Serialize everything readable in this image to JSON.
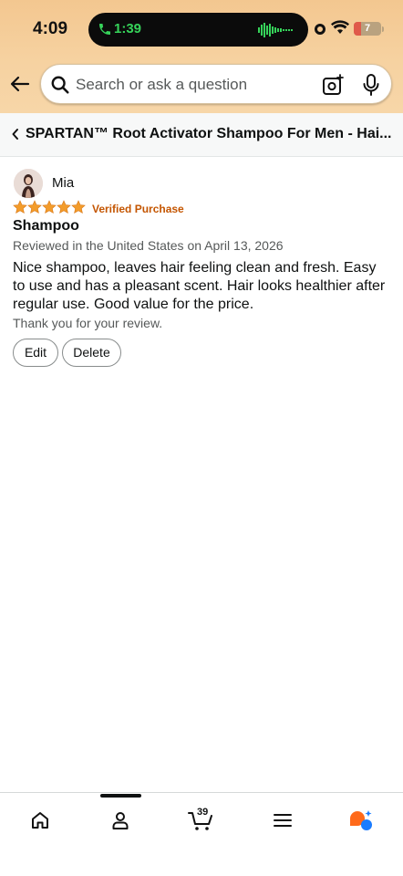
{
  "status_bar": {
    "time": "4:09",
    "call_time": "1:39",
    "battery": "7"
  },
  "search": {
    "placeholder": "Search or ask a question"
  },
  "breadcrumb": {
    "title": "SPARTAN™ Root Activator Shampoo For Men - Hai..."
  },
  "review": {
    "reviewer": "Mia",
    "rating": 5,
    "badge": "Verified Purchase",
    "title": "Shampoo",
    "date": "Reviewed in the United States on April 13, 2026",
    "body": "Nice shampoo, leaves hair feeling clean and fresh. Easy to use and has a pleasant scent. Hair looks healthier after regular use. Good value for the price.",
    "thanks": "Thank you for your review.",
    "edit_label": "Edit",
    "delete_label": "Delete"
  },
  "bottom_nav": {
    "items": [
      "home-icon",
      "account-icon",
      "cart-icon",
      "menu-icon",
      "rufus-icon"
    ],
    "cart_count": "39"
  },
  "colors": {
    "header_gradient": "#f3c790",
    "star": "#f39c2b",
    "verified": "#c45500",
    "call_green": "#36d35a",
    "rufus_orange": "#ff6a1a",
    "rufus_blue": "#1a7cff"
  }
}
